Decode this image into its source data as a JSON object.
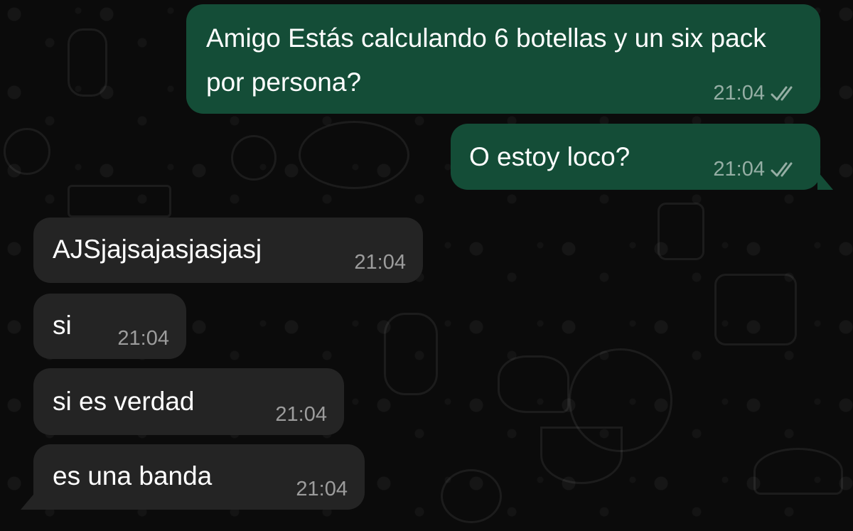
{
  "conversation": {
    "messages": [
      {
        "direction": "outgoing",
        "text": "Amigo Estás calculando 6 botellas y un six pack por persona?",
        "time": "21:04",
        "status": "read"
      },
      {
        "direction": "outgoing",
        "text": "O estoy loco?",
        "time": "21:04",
        "status": "read"
      },
      {
        "direction": "incoming",
        "text": "AJSjajsajasjasjasj",
        "time": "21:04"
      },
      {
        "direction": "incoming",
        "text": "si",
        "time": "21:04"
      },
      {
        "direction": "incoming",
        "text": "si es verdad",
        "time": "21:04"
      },
      {
        "direction": "incoming",
        "text": "es una banda",
        "time": "21:04"
      }
    ]
  },
  "colors": {
    "background": "#0b0b0b",
    "outgoing_bubble": "#144d37",
    "incoming_bubble": "#242424",
    "text": "#ffffff",
    "meta": "#8e9a95"
  },
  "icons": {
    "read_status": "double-check-icon"
  }
}
